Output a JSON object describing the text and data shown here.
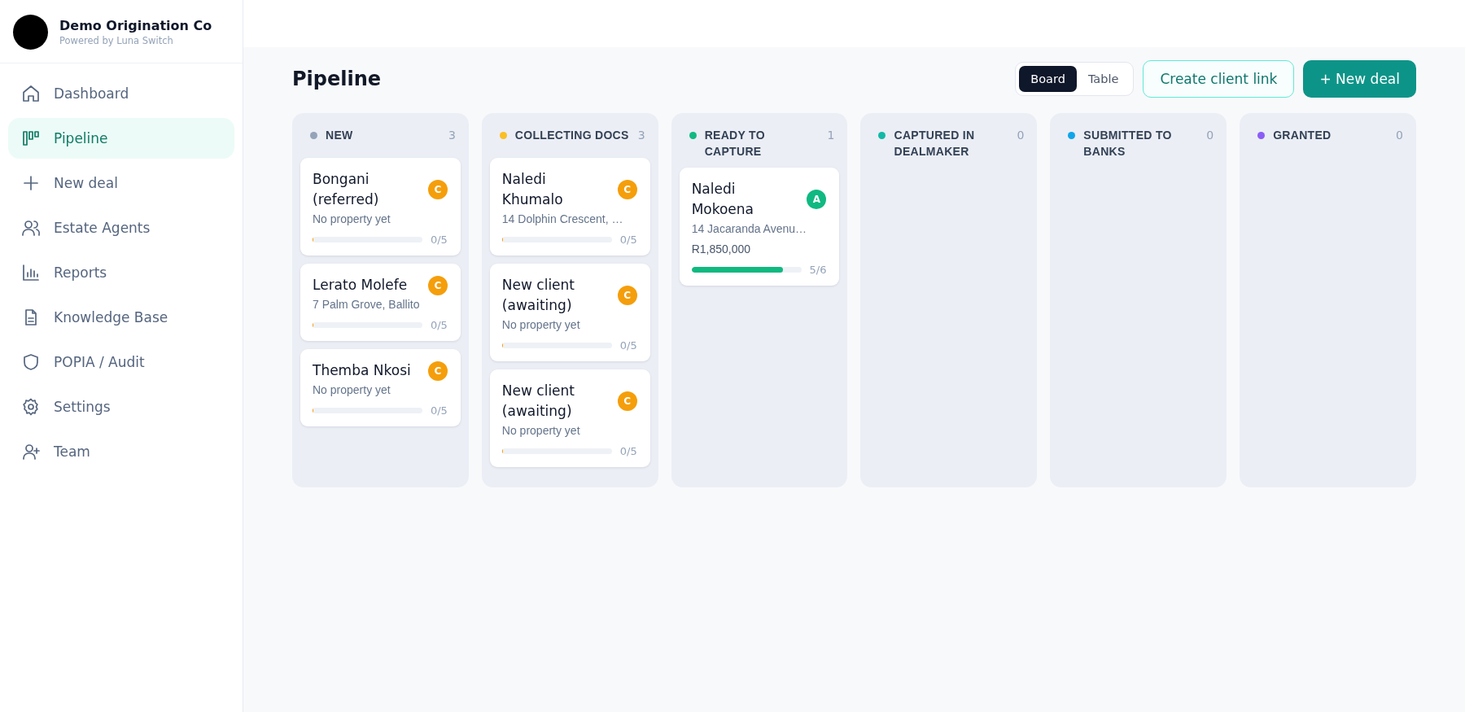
{
  "brand": {
    "name": "Demo Origination Co",
    "tagline": "Powered by Luna Switch"
  },
  "sidebar": {
    "items": [
      {
        "label": "Dashboard",
        "selected": false
      },
      {
        "label": "Pipeline",
        "selected": true
      },
      {
        "label": "New deal",
        "selected": false
      },
      {
        "label": "Estate Agents",
        "selected": false
      },
      {
        "label": "Reports",
        "selected": false
      },
      {
        "label": "Knowledge Base",
        "selected": false
      },
      {
        "label": "POPIA / Audit",
        "selected": false
      },
      {
        "label": "Settings",
        "selected": false
      },
      {
        "label": "Team",
        "selected": false
      }
    ]
  },
  "page": {
    "title": "Pipeline"
  },
  "view_toggle": [
    {
      "label": "Board",
      "selected": true
    },
    {
      "label": "Table",
      "selected": false
    }
  ],
  "buttons": [
    {
      "label": "Create client link",
      "kind": "outline"
    },
    {
      "label": "+ New deal",
      "kind": "primary"
    }
  ],
  "columns": [
    {
      "title": "NEW",
      "count": "3",
      "color": "#94a3b8",
      "cards": [
        {
          "name": "Bongani (referred)",
          "subtitle": "No property yet",
          "badge": "C",
          "color": "#f59e0b",
          "level": 0,
          "progress": "0/5"
        },
        {
          "name": "Lerato Molefe",
          "subtitle": "7 Palm Grove, Ballito",
          "badge": "C",
          "color": "#f59e0b",
          "level": 0,
          "progress": "0/5"
        },
        {
          "name": "Themba Nkosi",
          "subtitle": "No property yet",
          "badge": "C",
          "color": "#f59e0b",
          "level": 0,
          "progress": "0/5"
        }
      ]
    },
    {
      "title": "COLLECTING DOCS",
      "count": "3",
      "color": "#fbbf24",
      "cards": [
        {
          "name": "Naledi Khumalo",
          "subtitle": "14 Dolphin Crescent, …",
          "badge": "C",
          "color": "#f59e0b",
          "level": 0,
          "progress": "0/5"
        },
        {
          "name": "New client (awaiting)",
          "subtitle": "No property yet",
          "badge": "C",
          "color": "#f59e0b",
          "level": 0,
          "progress": "0/5"
        },
        {
          "name": "New client (awaiting)",
          "subtitle": "No property yet",
          "badge": "C",
          "color": "#f59e0b",
          "level": 0,
          "progress": "0/5"
        }
      ]
    },
    {
      "title": "READY TO CAPTURE",
      "count": "1",
      "color": "#10b981",
      "cards": [
        {
          "name": "Naledi Mokoena",
          "subtitle": "14 Jacaranda Avenu…",
          "amount": "R1,850,000",
          "badge": "A",
          "color": "#10b981",
          "level": 0.833,
          "progress": "5/6"
        }
      ]
    },
    {
      "title": "CAPTURED IN DEALMAKER",
      "count": "0",
      "color": "#14b8a6"
    },
    {
      "title": "SUBMITTED TO BANKS",
      "count": "0",
      "color": "#0ea5e9"
    },
    {
      "title": "GRANTED",
      "count": "0",
      "color": "#8b5cf6"
    }
  ]
}
